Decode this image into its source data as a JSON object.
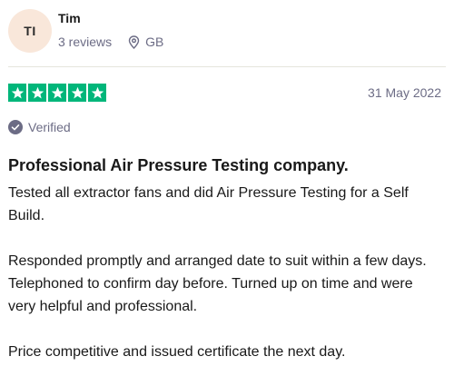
{
  "consumer": {
    "initials": "TI",
    "name": "Tim",
    "reviews": "3 reviews",
    "country": "GB"
  },
  "rating": {
    "stars": 5,
    "max_stars": 5,
    "color": "#00b67a",
    "date": "31 May 2022"
  },
  "verified_label": "Verified",
  "review": {
    "title": "Professional Air Pressure Testing company.",
    "paragraphs": [
      "Tested all extractor fans and did Air Pressure Testing for a Self Build.",
      "Responded promptly and arranged date to suit within a few days. Telephoned to confirm day before. Turned up on time and were very helpful and professional.",
      "Price competitive and issued certificate the next day."
    ]
  },
  "icons": {
    "location": "location-pin-icon",
    "verified": "verified-check-icon",
    "star": "star-icon"
  }
}
